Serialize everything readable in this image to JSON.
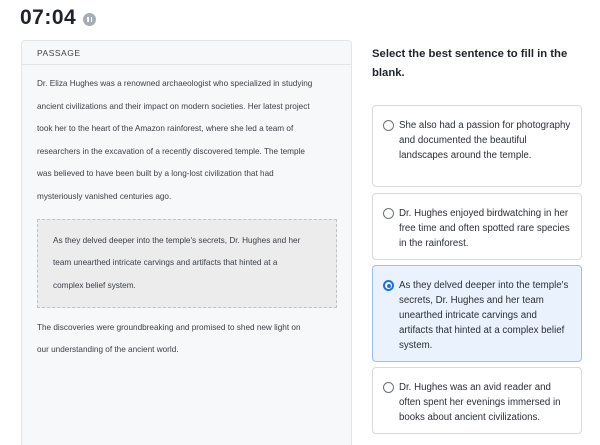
{
  "timer": {
    "value": "07:04",
    "control_icon": "pause-icon"
  },
  "passage": {
    "header": "PASSAGE",
    "paragraph1_lines": [
      "Dr. Eliza Hughes was a renowned archaeologist who specialized in studying",
      "ancient civilizations and their impact on modern societies. Her latest project",
      "took her to the heart of the Amazon rainforest, where she led a team of",
      "researchers in the excavation of a recently discovered temple. The temple",
      "was believed to have been built by a long-lost civilization that had",
      "mysteriously vanished centuries ago."
    ],
    "blank_lines": [
      "As they delved deeper into the temple's secrets, Dr. Hughes and her",
      "team unearthed intricate carvings and artifacts that hinted at a",
      "complex belief system."
    ],
    "paragraph2_lines": [
      "The discoveries were groundbreaking and promised to shed new light on",
      "our understanding of the ancient world."
    ]
  },
  "question": "Select the best sentence to fill in the blank.",
  "options": [
    {
      "text": "She also had a passion for photography and documented the beautiful landscapes around the temple.",
      "selected": false
    },
    {
      "text": "Dr. Hughes enjoyed birdwatching in her free time and often spotted rare species in the rainforest.",
      "selected": false
    },
    {
      "text": "As they delved deeper into the temple's secrets, Dr. Hughes and her team unearthed intricate carvings and artifacts that hinted at a complex belief system.",
      "selected": true
    },
    {
      "text": "Dr. Hughes was an avid reader and often spent her evenings immersed in books about ancient civilizations.",
      "selected": false
    }
  ],
  "colors": {
    "accent": "#1f6fdc",
    "selected_bg": "#eaf2fd",
    "panel_bg": "#f7f8fa"
  }
}
